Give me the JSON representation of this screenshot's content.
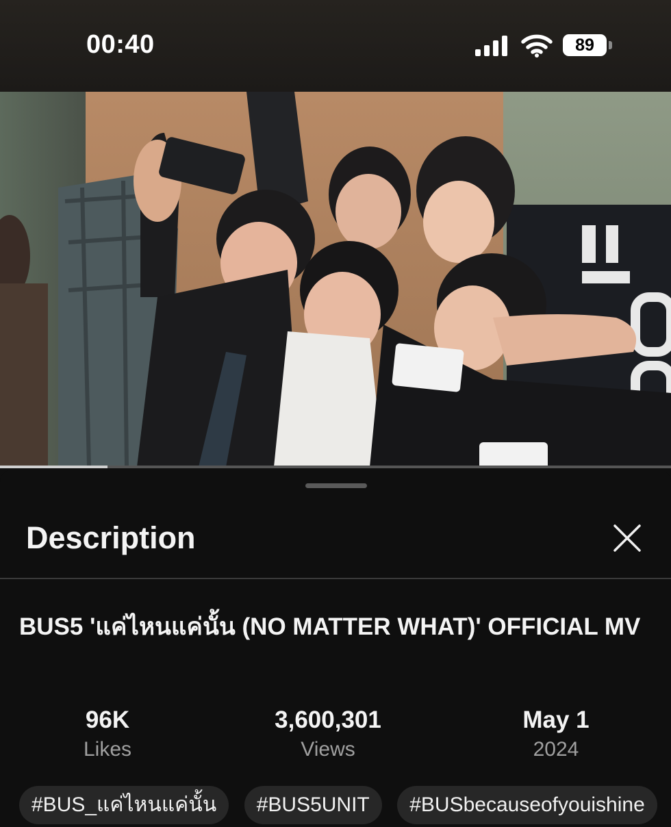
{
  "status_bar": {
    "time": "00:40",
    "battery": "89",
    "icons": [
      "signal-icon",
      "wifi-icon",
      "battery-icon"
    ]
  },
  "video": {
    "progress_fraction": 0.16
  },
  "sheet": {
    "title": "Description",
    "close_icon": "close-icon"
  },
  "video_info": {
    "title": "BUS5 'แค่ไหนแค่นั้น (NO MATTER WHAT)' OFFICIAL MV",
    "stats": [
      {
        "value": "96K",
        "label": "Likes"
      },
      {
        "value": "3,600,301",
        "label": "Views"
      },
      {
        "value": "May 1",
        "label": "2024"
      }
    ],
    "tags": [
      "#BUS_แค่ไหนแค่นั้น",
      "#BUS5UNIT",
      "#BUSbecauseofyouishine"
    ]
  },
  "colors": {
    "background": "#0f0f0f",
    "tag_bg": "#272727",
    "muted_text": "#a0a0a0"
  }
}
